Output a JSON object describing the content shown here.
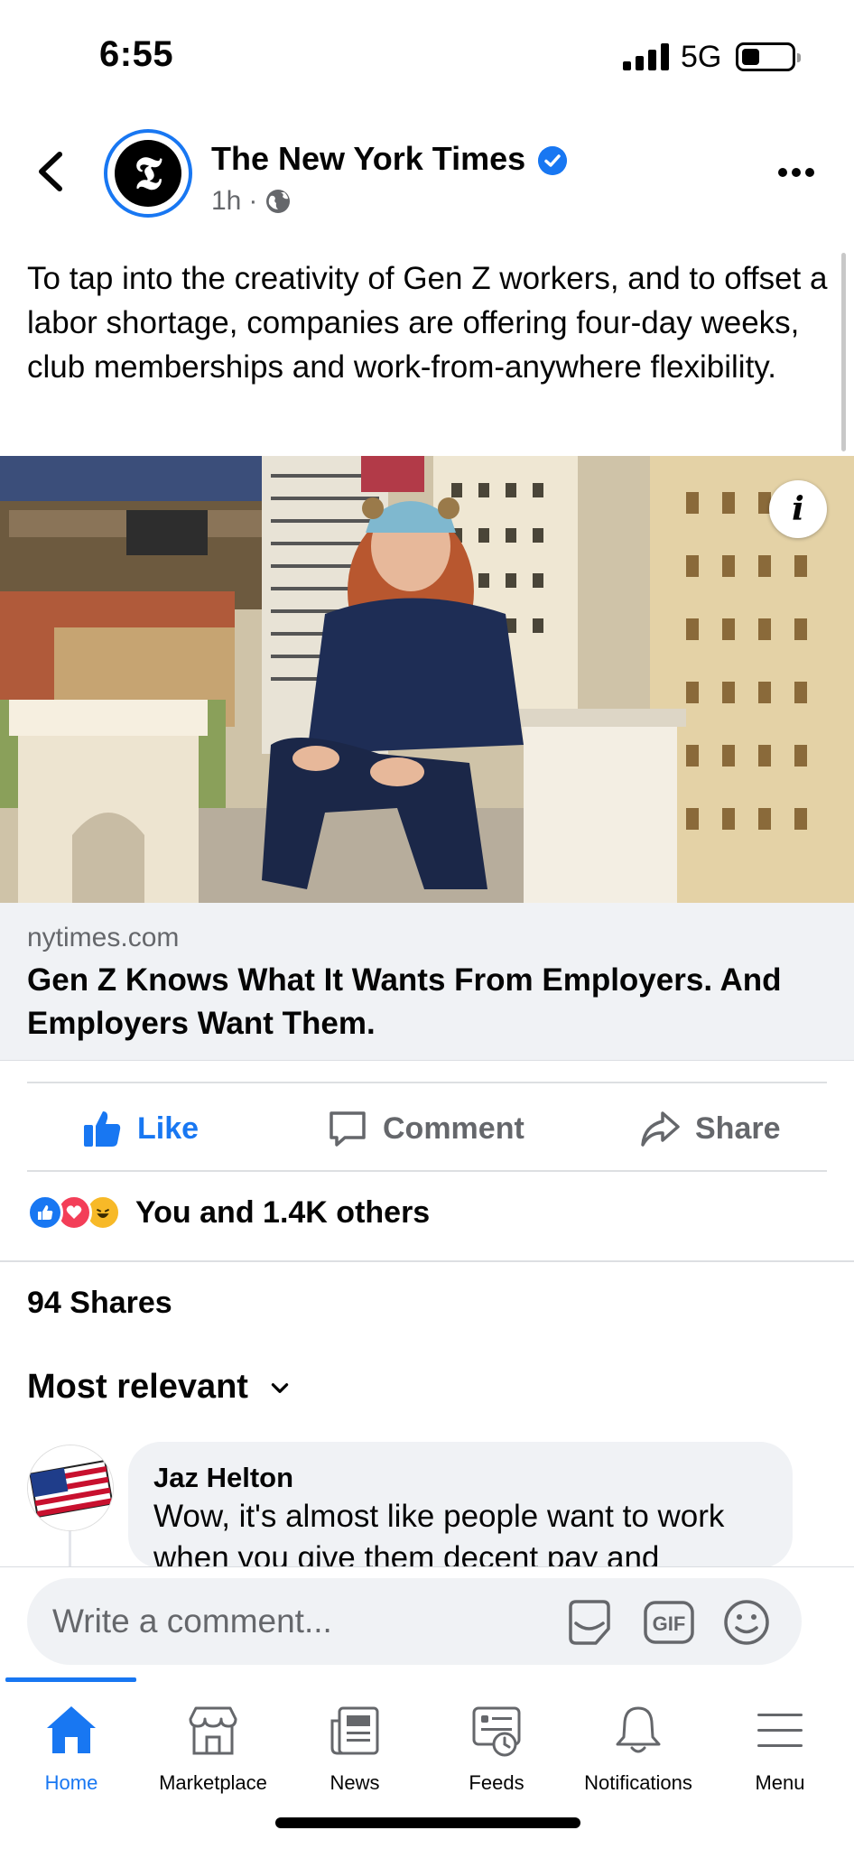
{
  "status_bar": {
    "time": "6:55",
    "network": "5G",
    "battery_percent": 35
  },
  "post": {
    "page_name": "The New York Times",
    "avatar_letter": "𝕿",
    "time_ago": "1h",
    "separator": "·",
    "text": "To tap into the creativity of Gen Z workers, and to offset a labor shortage, companies are offering four-day weeks, club memberships and work-from-anywhere flexibility.",
    "photo_icon": "info-icon",
    "info_glyph": "i",
    "link": {
      "domain": "nytimes.com",
      "title": "Gen Z Knows What It Wants From Employers. And Employers Want Them."
    }
  },
  "actions": {
    "like": "Like",
    "comment": "Comment",
    "share": "Share"
  },
  "reactions": {
    "summary": "You and 1.4K others",
    "types": [
      "like",
      "love",
      "haha"
    ]
  },
  "shares": "94 Shares",
  "sort_label": "Most relevant",
  "comment": {
    "author": "Jaz Helton",
    "text": "Wow, it's almost like people want to work when you give them decent pay and"
  },
  "composer": {
    "placeholder": "Write a comment..."
  },
  "nav": {
    "items": [
      {
        "label": "Home",
        "icon": "home-icon"
      },
      {
        "label": "Marketplace",
        "icon": "marketplace-icon"
      },
      {
        "label": "News",
        "icon": "news-icon"
      },
      {
        "label": "Feeds",
        "icon": "feeds-icon"
      },
      {
        "label": "Notifications",
        "icon": "bell-icon"
      },
      {
        "label": "Menu",
        "icon": "menu-icon"
      }
    ],
    "active": "Home"
  },
  "colors": {
    "brand": "#1877f2",
    "secondary_text": "#65676b",
    "love": "#f33e58",
    "haha": "#f7b928"
  }
}
